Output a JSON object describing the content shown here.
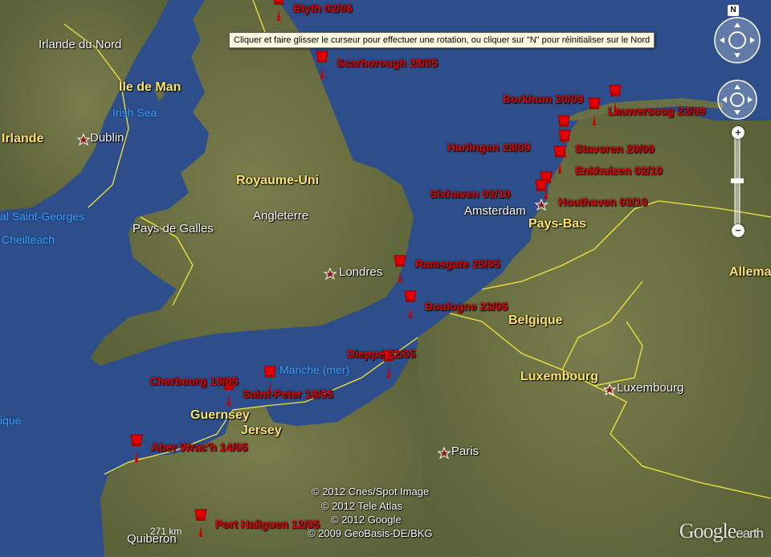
{
  "tooltip": "Cliquer et faire glisser le curseur pour effectuer une rotation, ou cliquer sur \"N\" pour réinitialiser sur le Nord",
  "north_label": "N",
  "zoom": {
    "plus": "+",
    "minus": "−"
  },
  "countries": {
    "uk": "Royaume-Uni",
    "netherlands": "Pays-Bas",
    "belgium": "Belgique",
    "luxembourg": "Luxembourg",
    "germany": "Allema",
    "isle_of_man": "Ile de Man",
    "guernsey": "Guernsey",
    "jersey": "Jersey"
  },
  "regions": {
    "northern_ireland": "Irlande du Nord",
    "ireland": "Irlande",
    "england": "Angleterre",
    "wales": "Pays de Galles"
  },
  "cities": {
    "dublin": "Dublin",
    "london": "Londres",
    "amsterdam": "Amsterdam",
    "paris": "Paris",
    "luxembourg": "Luxembourg",
    "quiberon": "Quiberon"
  },
  "water": {
    "irish_sea": "Irish Sea",
    "st_georges": "al Saint-Georges",
    "cheilteach": "Cheilteach",
    "manche": "Manche (mer)",
    "ique": "ique"
  },
  "placemarks": [
    {
      "id": "blyth",
      "label": "Blyth 02/06"
    },
    {
      "id": "scarborough",
      "label": "Scarborough 28/05"
    },
    {
      "id": "borkhum",
      "label": "Borkhum 20/09"
    },
    {
      "id": "lauwersoog",
      "label": "Lauwersoog 23/09"
    },
    {
      "id": "harlingen",
      "label": "Harlingen 28/09"
    },
    {
      "id": "stavoren",
      "label": "Stavoren 29/09"
    },
    {
      "id": "enkhuizen",
      "label": "Enkhuizen 02/10"
    },
    {
      "id": "sixhaven",
      "label": "Sixhaven  03/10"
    },
    {
      "id": "houthaven",
      "label": "Houthaven 03/10"
    },
    {
      "id": "ramsgate",
      "label": "Ramsgate 25/05"
    },
    {
      "id": "boulogne",
      "label": "Boulogne 23/05"
    },
    {
      "id": "dieppe",
      "label": "Dieppe 22/05"
    },
    {
      "id": "cherbourg",
      "label": "Cherbourg 19/05"
    },
    {
      "id": "saint_peter",
      "label": "Saint-Peter 18/05"
    },
    {
      "id": "aber_wrach",
      "label": "Aber Wrac'h 14/05"
    },
    {
      "id": "port_haliguen",
      "label": "Port Haliguen 12/05"
    }
  ],
  "credits": [
    "© 2012 Cnes/Spot Image",
    "© 2012 Tele Atlas",
    "© 2012 Google",
    "© 2009 GeoBasis-DE/BKG"
  ],
  "scale": "271 km",
  "brand": {
    "google": "Google",
    "earth": "earth"
  },
  "colors": {
    "sea": "#2d4e8a",
    "land": "#6e7445",
    "border": "#f2e640",
    "pin": "#e30000",
    "label_country": "#ffe66b"
  }
}
